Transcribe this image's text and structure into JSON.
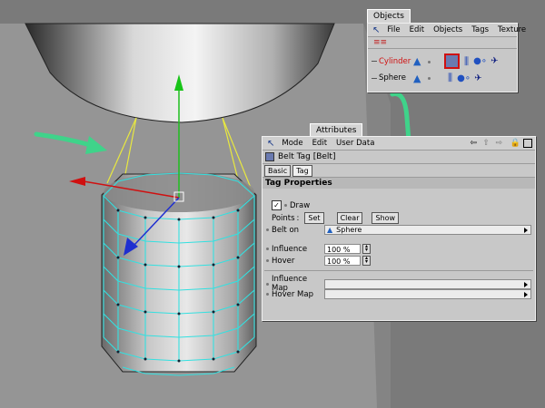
{
  "objects_panel": {
    "title": "Objects",
    "menu": [
      "File",
      "Edit",
      "Objects",
      "Tags",
      "Texture"
    ],
    "items": [
      {
        "name": "Cylinder",
        "color": "#d01010"
      },
      {
        "name": "Sphere",
        "color": "#000000"
      }
    ]
  },
  "attributes_panel": {
    "title": "Attributes",
    "menu": [
      "Mode",
      "Edit",
      "User Data"
    ],
    "object_title": "Belt Tag [Belt]",
    "tabs": [
      "Basic",
      "Tag"
    ],
    "section": "Tag Properties",
    "draw_label": "Draw",
    "points_label": "Points",
    "buttons": [
      "Set",
      "Clear",
      "Show"
    ],
    "belt_on_label": "Belt on",
    "belt_on_value": "Sphere",
    "influence_label": "Influence",
    "influence_value": "100 %",
    "hover_label": "Hover",
    "hover_value": "100 %",
    "influence_map_label": "Influence Map",
    "hover_map_label": "Hover Map"
  },
  "colors": {
    "viewport_bg": "#7a7a7a",
    "floor": "#949494",
    "wireframe": "#33e0e0",
    "annotation": "#3fd38a",
    "belt_lines": "#e8e840"
  }
}
